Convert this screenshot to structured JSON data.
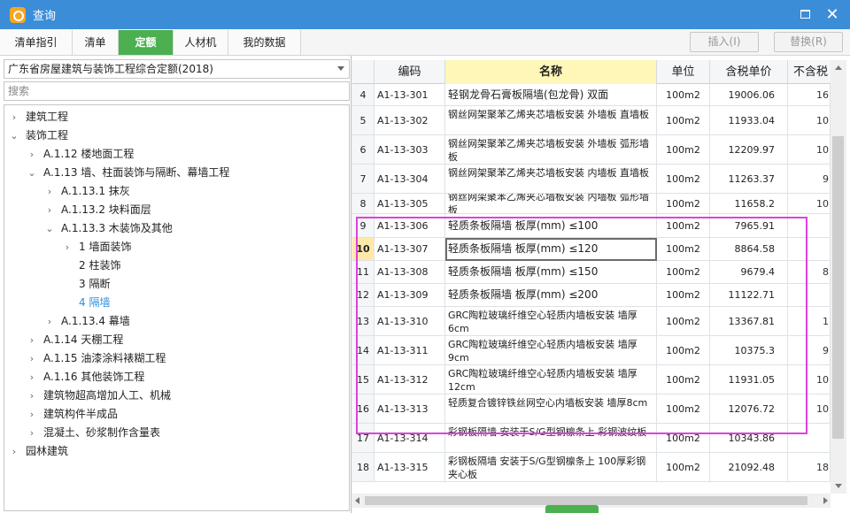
{
  "window": {
    "title": "查询"
  },
  "tabs": [
    "清单指引",
    "清单",
    "定额",
    "人材机",
    "我的数据"
  ],
  "actions": {
    "insert": "插入(I)",
    "replace": "替换(R)"
  },
  "left": {
    "dropdown_value": "广东省房屋建筑与装饰工程综合定额(2018)",
    "search_placeholder": "搜索",
    "tree": [
      "建筑工程",
      "装饰工程",
      "A.1.12 楼地面工程",
      "A.1.13 墙、柱面装饰与隔断、幕墙工程",
      "A.1.13.1 抹灰",
      "A.1.13.2 块料面层",
      "A.1.13.3 木装饰及其他",
      "1 墙面装饰",
      "2 柱装饰",
      "3 隔断",
      "4 隔墙",
      "A.1.13.4 幕墙",
      "A.1.14 天棚工程",
      "A.1.15 油漆涂料裱糊工程",
      "A.1.16 其他装饰工程",
      "建筑物超高增加人工、机械",
      "建筑构件半成品",
      "混凝土、砂浆制作含量表",
      "园林建筑"
    ]
  },
  "grid": {
    "headers": [
      "",
      "编码",
      "名称",
      "单位",
      "含税单价",
      "不含税"
    ],
    "rows": [
      {
        "num": "4",
        "code": "A1-13-301",
        "name": "轻钢龙骨石膏板隔墙(包龙骨) 双面",
        "unit": "100m2",
        "price": "19006.06",
        "extra": "16"
      },
      {
        "num": "5",
        "code": "A1-13-302",
        "name": "钢丝网架聚苯乙烯夹芯墙板安装 外墙板 直墙板",
        "unit": "100m2",
        "price": "11933.04",
        "extra": "10"
      },
      {
        "num": "6",
        "code": "A1-13-303",
        "name": "钢丝网架聚苯乙烯夹芯墙板安装 外墙板 弧形墙板",
        "unit": "100m2",
        "price": "12209.97",
        "extra": "10"
      },
      {
        "num": "7",
        "code": "A1-13-304",
        "name": "钢丝网架聚苯乙烯夹芯墙板安装 内墙板 直墙板",
        "unit": "100m2",
        "price": "11263.37",
        "extra": "9"
      },
      {
        "num": "8",
        "code": "A1-13-305",
        "name": "钢丝网架聚苯乙烯夹芯墙板安装 内墙板 弧形墙板",
        "unit": "100m2",
        "price": "11658.2",
        "extra": "10"
      },
      {
        "num": "9",
        "code": "A1-13-306",
        "name": "轻质条板隔墙 板厚(mm) ≤100",
        "unit": "100m2",
        "price": "7965.91",
        "extra": ""
      },
      {
        "num": "10",
        "code": "A1-13-307",
        "name": "轻质条板隔墙 板厚(mm) ≤120",
        "unit": "100m2",
        "price": "8864.58",
        "extra": ""
      },
      {
        "num": "11",
        "code": "A1-13-308",
        "name": "轻质条板隔墙 板厚(mm) ≤150",
        "unit": "100m2",
        "price": "9679.4",
        "extra": "8"
      },
      {
        "num": "12",
        "code": "A1-13-309",
        "name": "轻质条板隔墙 板厚(mm) ≤200",
        "unit": "100m2",
        "price": "11122.71",
        "extra": ""
      },
      {
        "num": "13",
        "code": "A1-13-310",
        "name": "GRC陶粒玻璃纤维空心轻质内墙板安装 墙厚6cm",
        "unit": "100m2",
        "price": "13367.81",
        "extra": "1"
      },
      {
        "num": "14",
        "code": "A1-13-311",
        "name": "GRC陶粒玻璃纤维空心轻质内墙板安装 墙厚9cm",
        "unit": "100m2",
        "price": "10375.3",
        "extra": "9"
      },
      {
        "num": "15",
        "code": "A1-13-312",
        "name": "GRC陶粒玻璃纤维空心轻质内墙板安装 墙厚12cm",
        "unit": "100m2",
        "price": "11931.05",
        "extra": "10"
      },
      {
        "num": "16",
        "code": "A1-13-313",
        "name": "轻质复合镀锌铁丝网空心内墙板安装 墙厚8cm",
        "unit": "100m2",
        "price": "12076.72",
        "extra": "10"
      },
      {
        "num": "17",
        "code": "A1-13-314",
        "name": "彩钢板隔墙 安装于S/G型钢檩条上 彩钢波纹板",
        "unit": "100m2",
        "price": "10343.86",
        "extra": ""
      },
      {
        "num": "18",
        "code": "A1-13-315",
        "name": "彩钢板隔墙 安装于S/G型钢檩条上 100厚彩钢夹心板",
        "unit": "100m2",
        "price": "21092.48",
        "extra": "18"
      }
    ]
  },
  "colors": {
    "titlebar": "#3c8dd8",
    "active_tab": "#4caf50",
    "highlight": "#e040e0",
    "selected_tree": "#2f8fe0"
  }
}
